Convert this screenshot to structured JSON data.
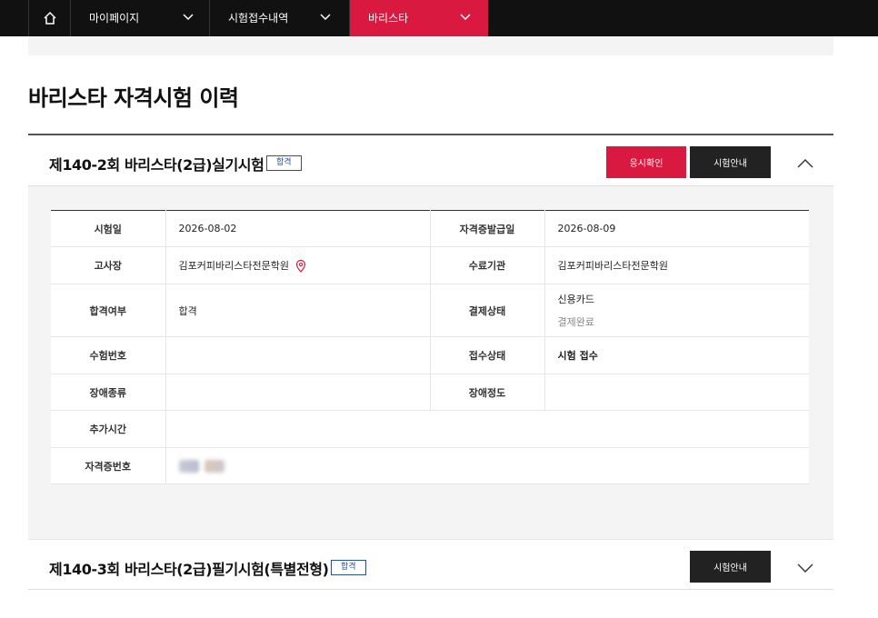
{
  "nav": {
    "item1": "마이페이지",
    "item2": "시험접수내역",
    "item3": "바리스타"
  },
  "page_title": "바리스타 자격시험 이력",
  "exam1": {
    "title": "제140-2회 바리스타(2급)실기시험",
    "badge": "합격",
    "btn_confirm": "응시확인",
    "btn_info": "시험안내",
    "rows": {
      "exam_date_label": "시험일",
      "exam_date": "2026-08-02",
      "cert_issue_label": "자격증발급일",
      "cert_issue": "2026-08-09",
      "venue_label": "고사장",
      "venue": "김포커피바리스타전문학원",
      "institution_label": "수료기관",
      "institution": "김포커피바리스타전문학원",
      "pass_label": "합격여부",
      "pass": "합격",
      "payment_label": "결제상태",
      "payment_method": "신용카드",
      "payment_status": "결제완료",
      "examinee_label": "수험번호",
      "examinee": "",
      "reception_label": "접수상태",
      "reception": "시험 접수",
      "disability_type_label": "장애종류",
      "disability_type": "",
      "disability_level_label": "장애정도",
      "disability_level": "",
      "extra_time_label": "추가시간",
      "extra_time": "",
      "cert_no_label": "자격증번호"
    }
  },
  "exam2": {
    "title": "제140-3회 바리스타(2급)필기시험(특별전형)",
    "badge": "합격",
    "btn_info": "시험안내"
  },
  "colors": {
    "accent": "#d9193f",
    "nav_bg": "#111111",
    "badge": "#2a4fa0"
  }
}
